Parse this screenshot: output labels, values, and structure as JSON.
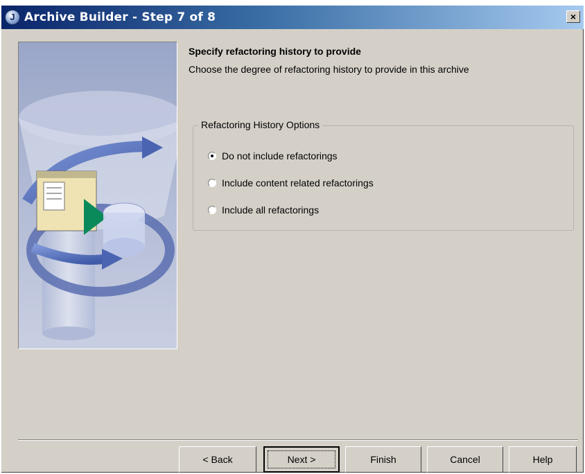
{
  "window": {
    "title": "Archive Builder - Step 7 of 8",
    "close_label": "×",
    "app_icon_glyph": "J"
  },
  "page": {
    "heading": "Specify refactoring history to provide",
    "description": "Choose the degree of refactoring history to provide in this archive"
  },
  "options": {
    "group_label": "Refactoring History Options",
    "items": [
      {
        "label": "Do not include refactorings",
        "checked": true
      },
      {
        "label": "Include content related refactorings",
        "checked": false
      },
      {
        "label": "Include all refactorings",
        "checked": false
      }
    ]
  },
  "buttons": {
    "back": "< Back",
    "next": "Next >",
    "finish": "Finish",
    "cancel": "Cancel",
    "help": "Help"
  },
  "colors": {
    "dialog_bg": "#d4d0c8",
    "titlebar_start": "#0a246a",
    "titlebar_end": "#a6caf0",
    "banner_arrow_blue": "#5b79c4",
    "banner_arrow_green": "#0a8a5a"
  }
}
